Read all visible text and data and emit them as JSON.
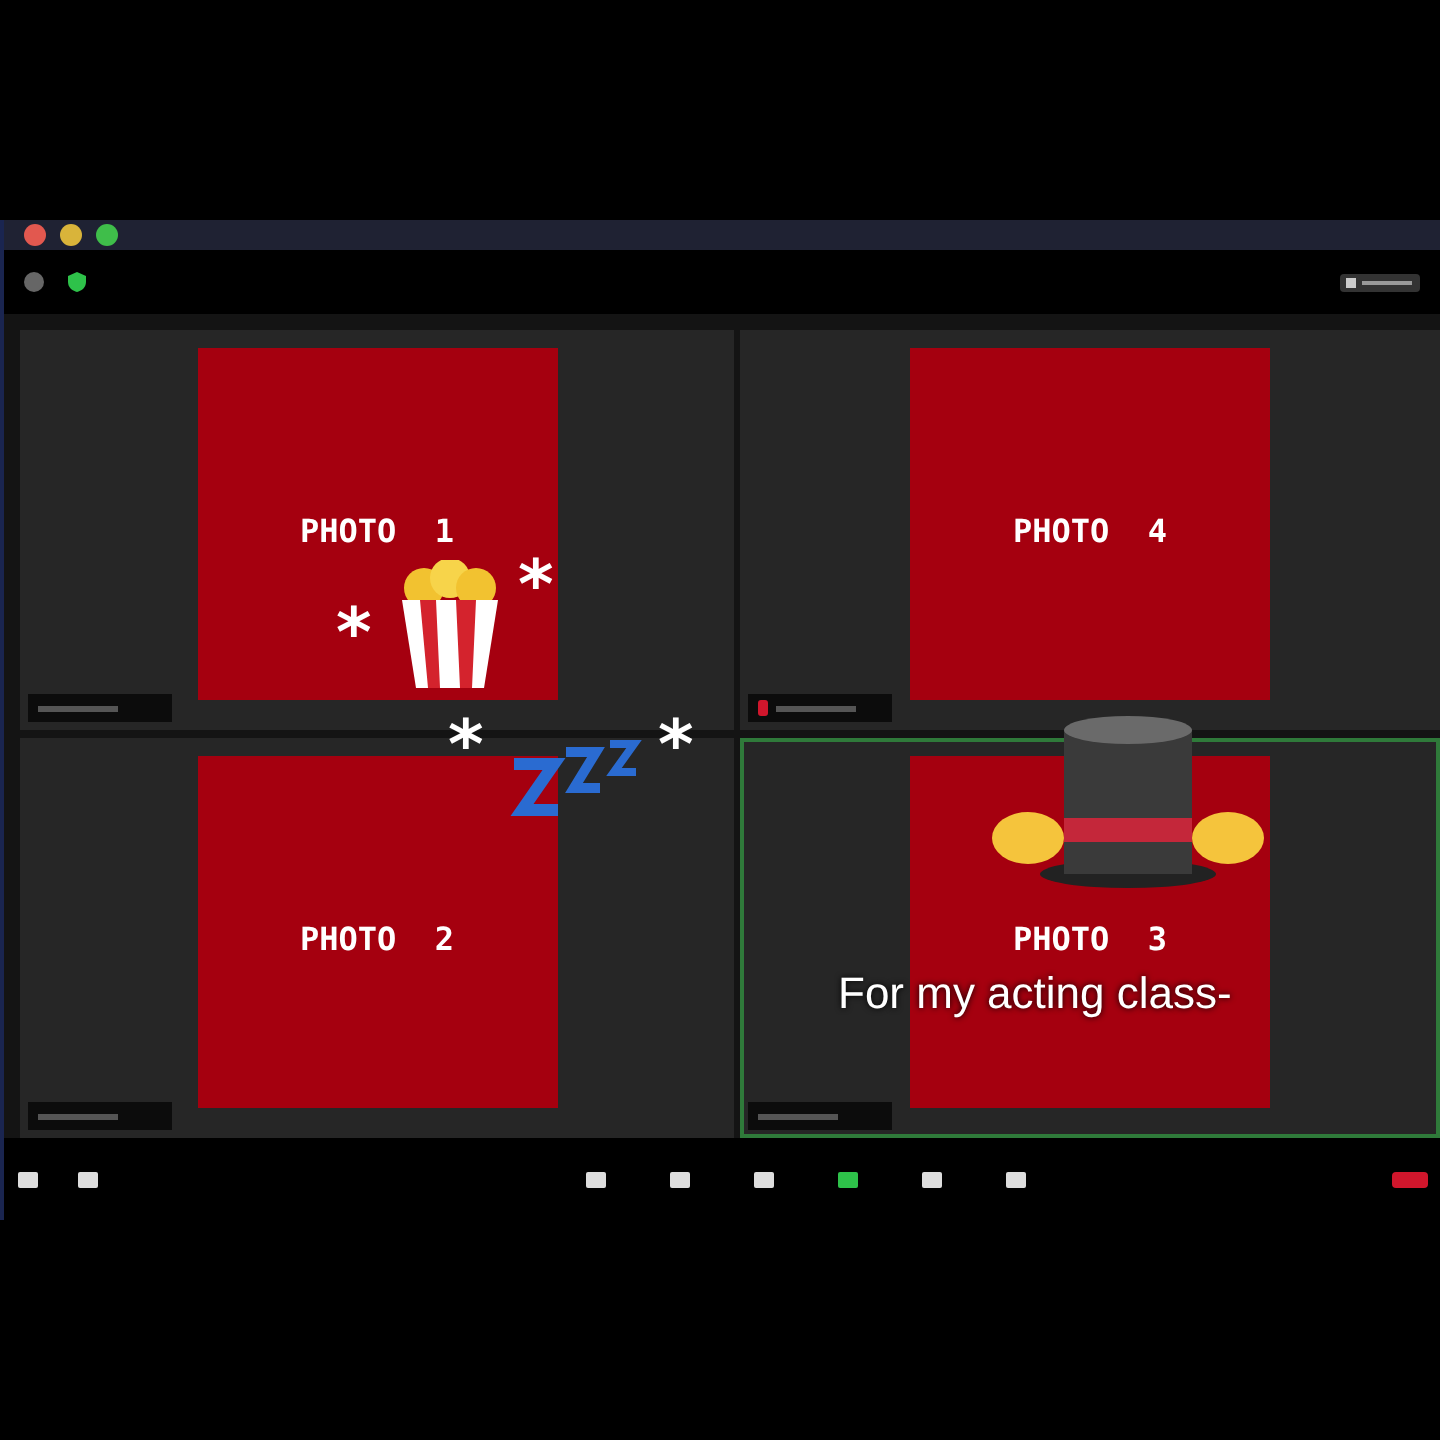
{
  "tiles": [
    {
      "label": "PHOTO  1",
      "muted": false,
      "active": false
    },
    {
      "label": "PHOTO  4",
      "muted": true,
      "active": false
    },
    {
      "label": "PHOTO  2",
      "muted": false,
      "active": false
    },
    {
      "label": "PHOTO  3",
      "muted": false,
      "active": true
    }
  ],
  "sparkles": [
    "*",
    "*",
    "*",
    "*"
  ],
  "caption": "For my acting class-"
}
